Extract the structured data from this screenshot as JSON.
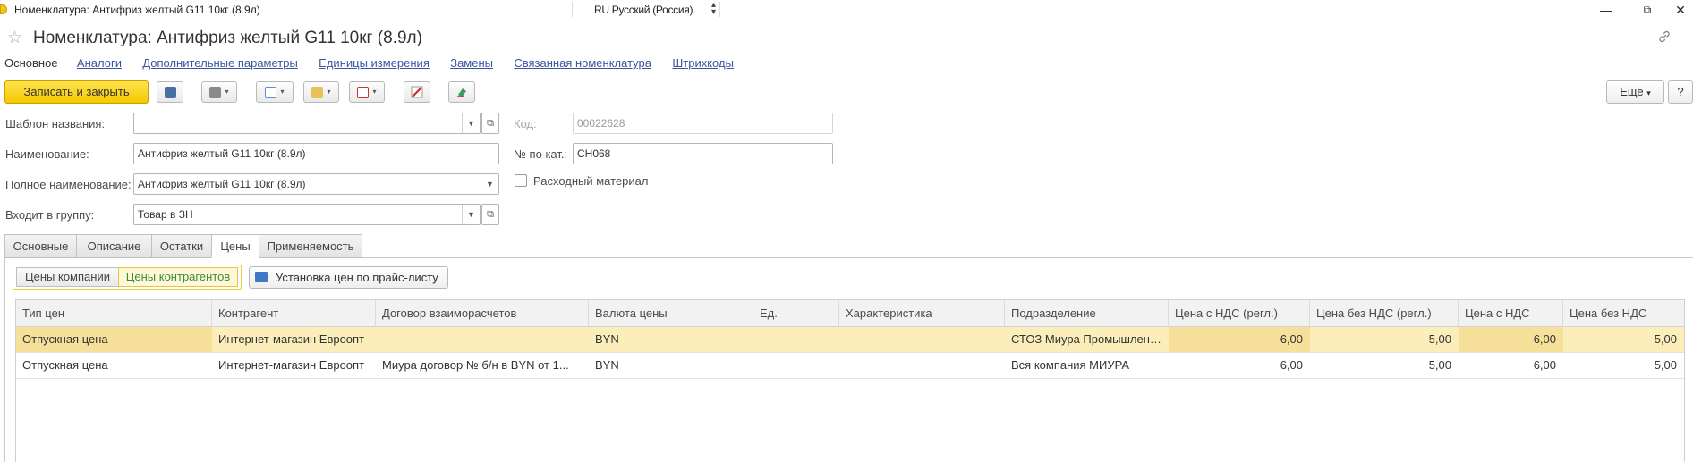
{
  "window": {
    "title": "Номенклатура: Антифриз желтый G11 10кг (8.9л)",
    "language": "RU Русский (Россия)",
    "minimize": "—",
    "restore": "⧉",
    "close": "✕"
  },
  "header": {
    "title": "Номенклатура: Антифриз желтый G11 10кг (8.9л)",
    "star": "☆",
    "link_icon": "🔗"
  },
  "nav": [
    "Основное",
    "Аналоги",
    "Дополнительные параметры",
    "Единицы измерения",
    "Замены",
    "Связанная номенклатура",
    "Штрихкоды"
  ],
  "toolbar": {
    "save_close": "Записать и закрыть",
    "more": "Еще",
    "more_arrow": "▾",
    "help": "?",
    "buttons": [
      {
        "name": "save-icon",
        "color": "#4a6fa5"
      },
      {
        "name": "print-icon",
        "color": "#7a7a7a"
      },
      {
        "name": "report-icon",
        "color": "#5a8fd0"
      },
      {
        "name": "create-based-on-icon",
        "color": "#c9a13a"
      },
      {
        "name": "pdf-icon",
        "color": "#c0392b"
      },
      {
        "name": "delete-mark-icon",
        "color": "#cc2222"
      },
      {
        "name": "clear-icon",
        "color": "#3c9a5f"
      }
    ]
  },
  "form": {
    "template_label": "Шаблон названия:",
    "template_value": "",
    "name_label": "Наименование:",
    "name_value": "Антифриз желтый G11 10кг (8.9л)",
    "fullname_label": "Полное наименование:",
    "fullname_value": "Антифриз желтый G11 10кг (8.9л)",
    "group_label": "Входит в группу:",
    "group_value": "Товар в ЗН",
    "code_label": "Код:",
    "code_value": "00022628",
    "catalog_label": "№ по кат.:",
    "catalog_value": "CH068",
    "consumable_label": "Расходный материал",
    "consumable_checked": false
  },
  "tabs": [
    "Основные",
    "Описание",
    "Остатки",
    "Цены",
    "Применяемость"
  ],
  "active_tab": "Цены",
  "subtabs": [
    "Цены компании",
    "Цены контрагентов"
  ],
  "active_subtab": "Цены контрагентов",
  "price_button": "Установка цен по прайс-листу",
  "grid": {
    "columns": [
      "Тип цен",
      "Контрагент",
      "Договор взаиморасчетов",
      "Валюта цены",
      "Ед.",
      "Характеристика",
      "Подразделение",
      "Цена с НДС (регл.)",
      "Цена без НДС (регл.)",
      "Цена с НДС",
      "Цена без НДС"
    ],
    "rows": [
      [
        "Отпускная цена",
        "Интернет-магазин Евроопт",
        "",
        "BYN",
        "",
        "",
        "СТОЗ Миура Промышленная",
        "6,00",
        "5,00",
        "6,00",
        "5,00"
      ],
      [
        "Отпускная цена",
        "Интернет-магазин Евроопт",
        "Миура договор № б/н в BYN от 1...",
        "BYN",
        "",
        "",
        "Вся компания МИУРА",
        "6,00",
        "5,00",
        "6,00",
        "5,00"
      ]
    ]
  }
}
